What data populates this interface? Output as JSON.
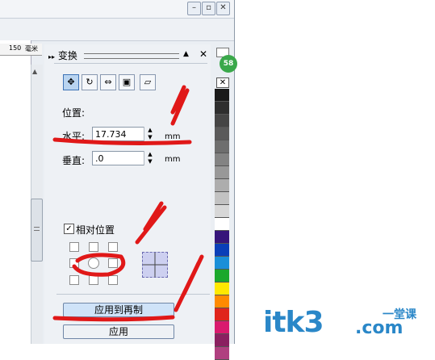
{
  "window": {
    "minimize_icon": "minimize-icon",
    "restore_icon": "restore-icon",
    "close_icon": "close-icon"
  },
  "ruler": {
    "tick": "150",
    "unit": "毫米"
  },
  "docker": {
    "title": "变换",
    "tabs": [
      "position-icon",
      "rotate-icon",
      "scale-icon",
      "size-icon",
      "skew-icon"
    ],
    "position_label": "位置:",
    "horizontal": {
      "label": "水平:",
      "value": "17.734",
      "unit": "mm"
    },
    "vertical": {
      "label": "垂直:",
      "value": ".0",
      "unit": "mm"
    },
    "relative": {
      "label": "相对位置",
      "checked": true
    },
    "apply_copy": "应用到再制",
    "apply": "应用"
  },
  "badge": {
    "value": "58"
  },
  "watermark": {
    "brand": "itk3",
    "suffix": ".com",
    "tagline": "一堂课"
  },
  "palette": [
    "#1a1a1a",
    "#2e2e2e",
    "#454545",
    "#5a5a5a",
    "#6e6e6e",
    "#838383",
    "#989898",
    "#adadad",
    "#c2c2c2",
    "#d7d7d7",
    "#ffffff",
    "#36157a",
    "#0a3fb8",
    "#1a8fd8",
    "#1aa82c",
    "#ffe800",
    "#ff8a00",
    "#e0241c",
    "#d91a6e",
    "#8a2060",
    "#b04080"
  ],
  "colors": {
    "annotation": "#e01818",
    "active_tab": "#b9d4f0",
    "primary_button": "#cfe3f8"
  }
}
